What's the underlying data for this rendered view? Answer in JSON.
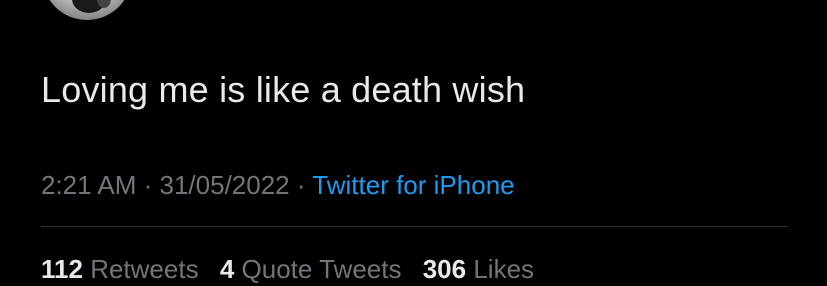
{
  "tweet": {
    "text": "Loving me is like a death wish",
    "time": "2:21 AM",
    "separator": " · ",
    "date": "31/05/2022",
    "source": "Twitter for iPhone"
  },
  "stats": {
    "retweets_count": "112",
    "retweets_label": "Retweets",
    "quotes_count": "4",
    "quotes_label": "Quote Tweets",
    "likes_count": "306",
    "likes_label": "Likes"
  },
  "colors": {
    "background": "#000000",
    "text": "#e7e9ea",
    "secondary": "#71767b",
    "link": "#1d9bf0",
    "divider": "#2f3336"
  }
}
